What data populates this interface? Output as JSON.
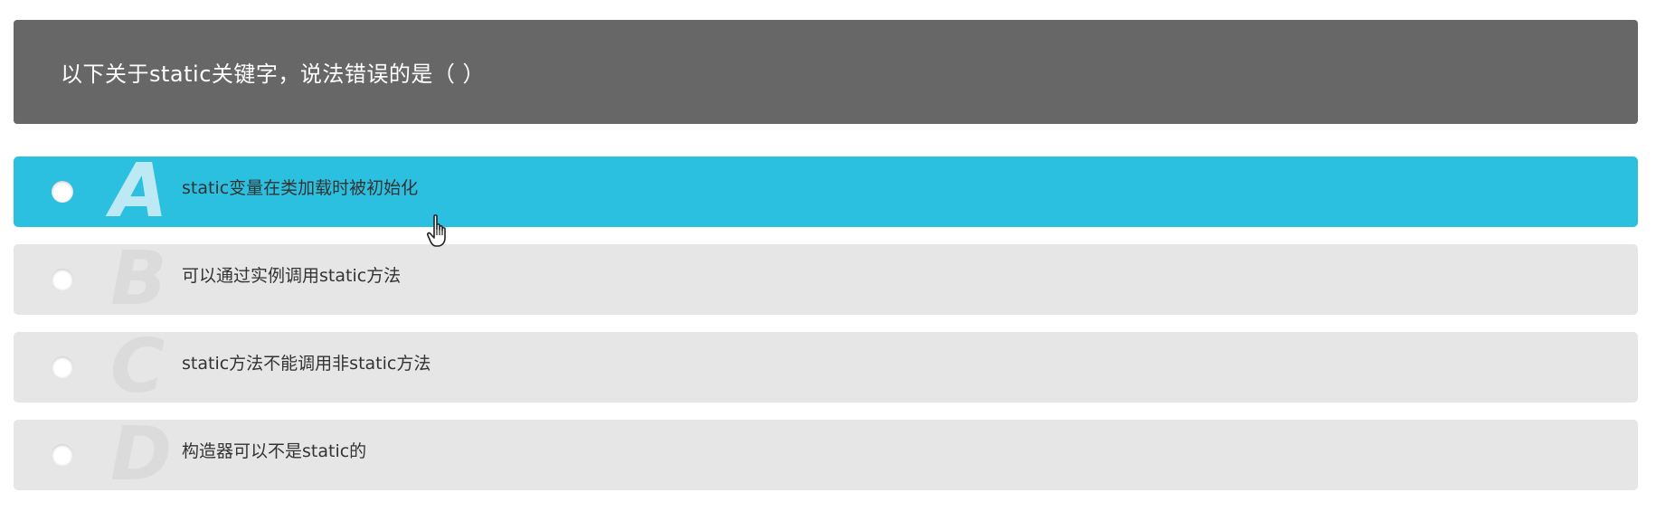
{
  "question": {
    "text": "以下关于static关键字，说法错误的是（ ）"
  },
  "options": [
    {
      "letter": "A",
      "text": "static变量在类加载时被初始化",
      "selected": true
    },
    {
      "letter": "B",
      "text": "可以通过实例调用static方法",
      "selected": false
    },
    {
      "letter": "C",
      "text": "static方法不能调用非static方法",
      "selected": false
    },
    {
      "letter": "D",
      "text": "构造器可以不是static的",
      "selected": false
    }
  ],
  "colors": {
    "header_bg": "#676767",
    "selected_bg": "#2cc0e0",
    "option_bg": "#e7e6e7"
  },
  "icons": {
    "cursor": "hand-pointer-icon"
  }
}
